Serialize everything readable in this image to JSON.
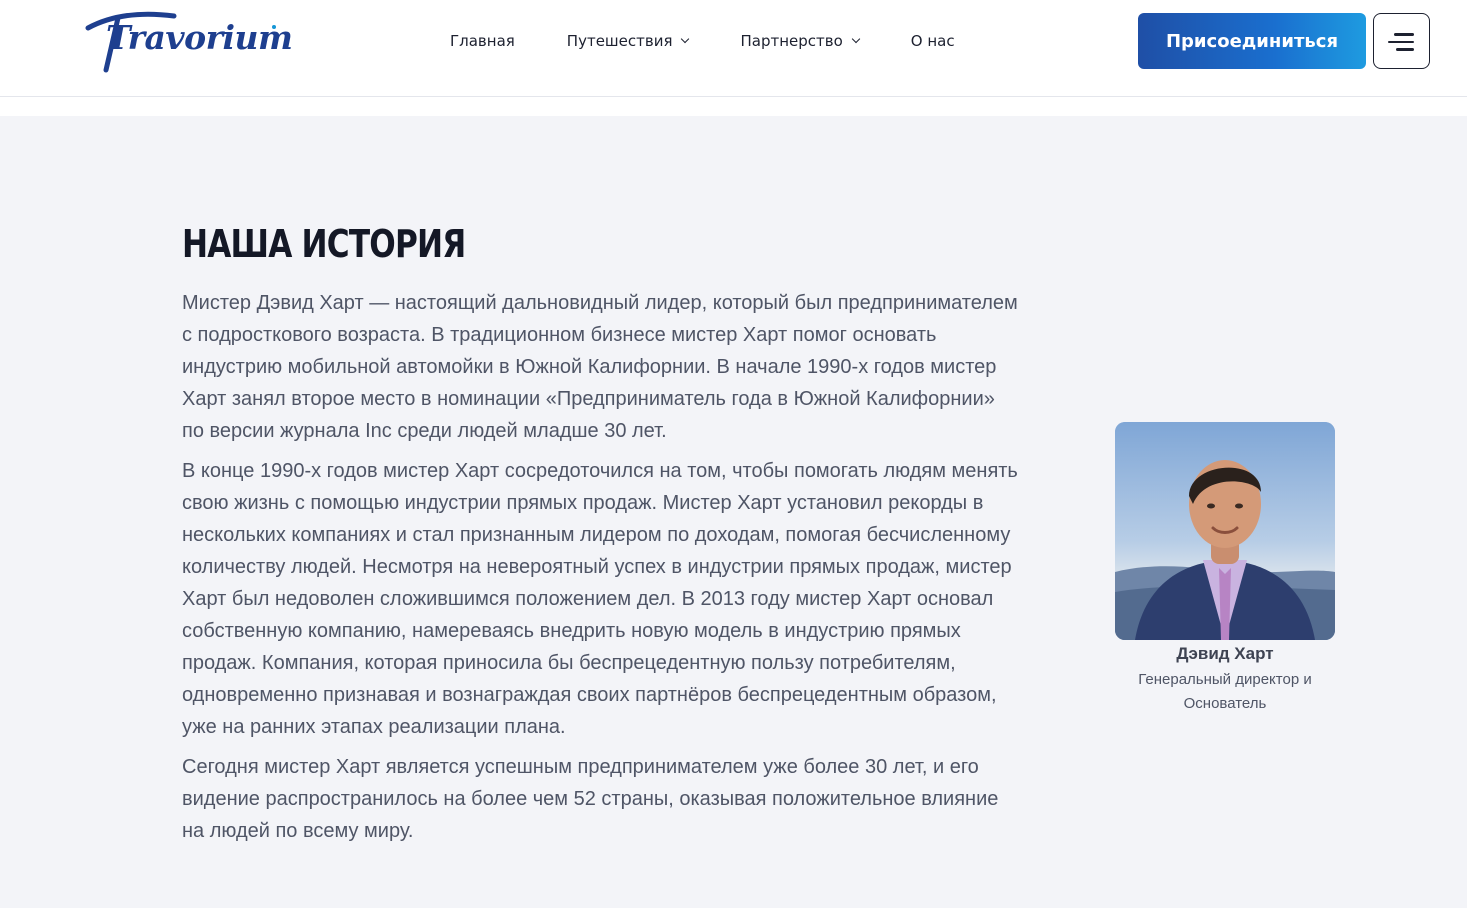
{
  "header": {
    "logo_text": "Travorium",
    "nav": {
      "home": "Главная",
      "travel": "Путешествия",
      "partnership": "Партнерство",
      "about": "О нас"
    },
    "join_label": "Присоединиться",
    "menu_icon": "hamburger-menu-icon"
  },
  "main": {
    "title": "НАША ИСТОРИЯ",
    "paragraphs": [
      "Мистер Дэвид Харт — настоящий дальновидный лидер, который был предпринимателем с подросткового возраста. В традиционном бизнесе мистер Харт помог основать индустрию мобильной автомойки в Южной Калифорнии. В начале 1990-х годов мистер Харт занял второе место в номинации «Предприниматель года в Южной Калифорнии» по версии журнала Inc среди людей младше 30 лет.",
      "В конце 1990-х годов мистер Харт сосредоточился на том, чтобы помогать людям менять свою жизнь с помощью индустрии прямых продаж. Мистер Харт установил рекорды в нескольких компаниях и стал признанным лидером по доходам, помогая бесчисленному количеству людей. Несмотря на невероятный успех в индустрии прямых продаж, мистер Харт был недоволен сложившимся положением дел. В 2013 году мистер Харт основал собственную компанию, намереваясь внедрить новую модель в индустрию прямых продаж. Компания, которая приносила бы беспрецедентную пользу потребителям, одновременно признавая и вознаграждая своих партнёров беспрецедентным образом, уже на ранних этапах реализации плана.",
      "Сегодня мистер Харт является успешным предпринимателем уже более 30 лет, и его видение распространилось на более чем 52 страны, оказывая положительное влияние на людей по всему миру."
    ],
    "profile": {
      "name": "Дэвид Харт",
      "role": "Генеральный директор и Основатель"
    }
  },
  "colors": {
    "brand_dark": "#1e3f8f",
    "brand_light": "#1596d6",
    "page_bg": "#f3f4f8",
    "body_text": "#4f5566"
  }
}
